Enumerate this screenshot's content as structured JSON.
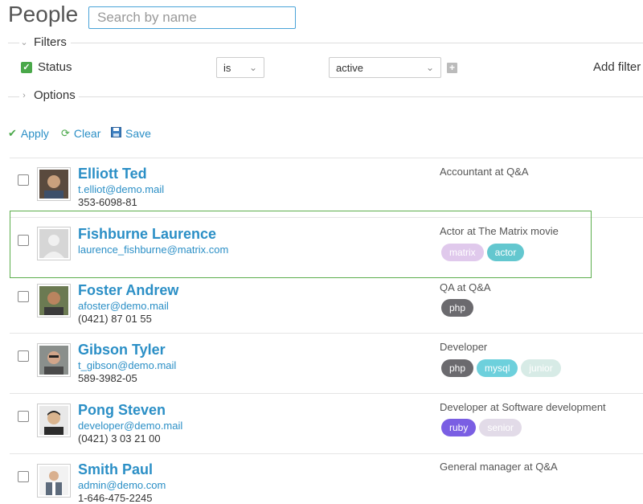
{
  "header": {
    "title": "People",
    "search_placeholder": "Search by name"
  },
  "filters": {
    "section_label": "Filters",
    "status_label": "Status",
    "operator_value": "is",
    "status_value": "active",
    "add_filter_label": "Add filter"
  },
  "options": {
    "section_label": "Options"
  },
  "actions": {
    "apply": "Apply",
    "clear": "Clear",
    "save": "Save"
  },
  "colors": {
    "link": "#2b8fc6",
    "highlight": "#5cae4c",
    "checkbox": "#4aa84a"
  },
  "people": [
    {
      "name": "Elliott Ted",
      "email": "t.elliot@demo.mail",
      "phone": "353-6098-81",
      "title": "Accountant at Q&A",
      "tags": []
    },
    {
      "name": "Fishburne Laurence",
      "email": "laurence_fishburne@matrix.com",
      "phone": "",
      "title": "Actor at The Matrix movie",
      "tags": [
        {
          "label": "matrix",
          "bg": "#e0c9ec",
          "fg": "#ffffff"
        },
        {
          "label": "actor",
          "bg": "#63c7cf",
          "fg": "#ffffff"
        }
      ]
    },
    {
      "name": "Foster Andrew",
      "email": "afoster@demo.mail",
      "phone": "(0421) 87 01 55",
      "title": "QA at Q&A",
      "tags": [
        {
          "label": "php",
          "bg": "#6b6a6e",
          "fg": "#ffffff"
        }
      ]
    },
    {
      "name": "Gibson Tyler",
      "email": "t_gibson@demo.mail",
      "phone": "589-3982-05",
      "title": "Developer",
      "tags": [
        {
          "label": "php",
          "bg": "#6b6a6e",
          "fg": "#ffffff"
        },
        {
          "label": "mysql",
          "bg": "#6dd0dc",
          "fg": "#ffffff"
        },
        {
          "label": "junior",
          "bg": "#d7ebe6",
          "fg": "#ffffff"
        }
      ]
    },
    {
      "name": "Pong Steven",
      "email": "developer@demo.mail",
      "phone": "(0421) 3 03 21 00",
      "title": "Developer at Software development",
      "tags": [
        {
          "label": "ruby",
          "bg": "#7a5ee3",
          "fg": "#ffffff"
        },
        {
          "label": "senior",
          "bg": "#e2dbe8",
          "fg": "#ffffff"
        }
      ]
    },
    {
      "name": "Smith Paul",
      "email": "admin@demo.com",
      "phone": "1-646-475-2245",
      "title": "General manager at Q&A",
      "tags": []
    }
  ]
}
